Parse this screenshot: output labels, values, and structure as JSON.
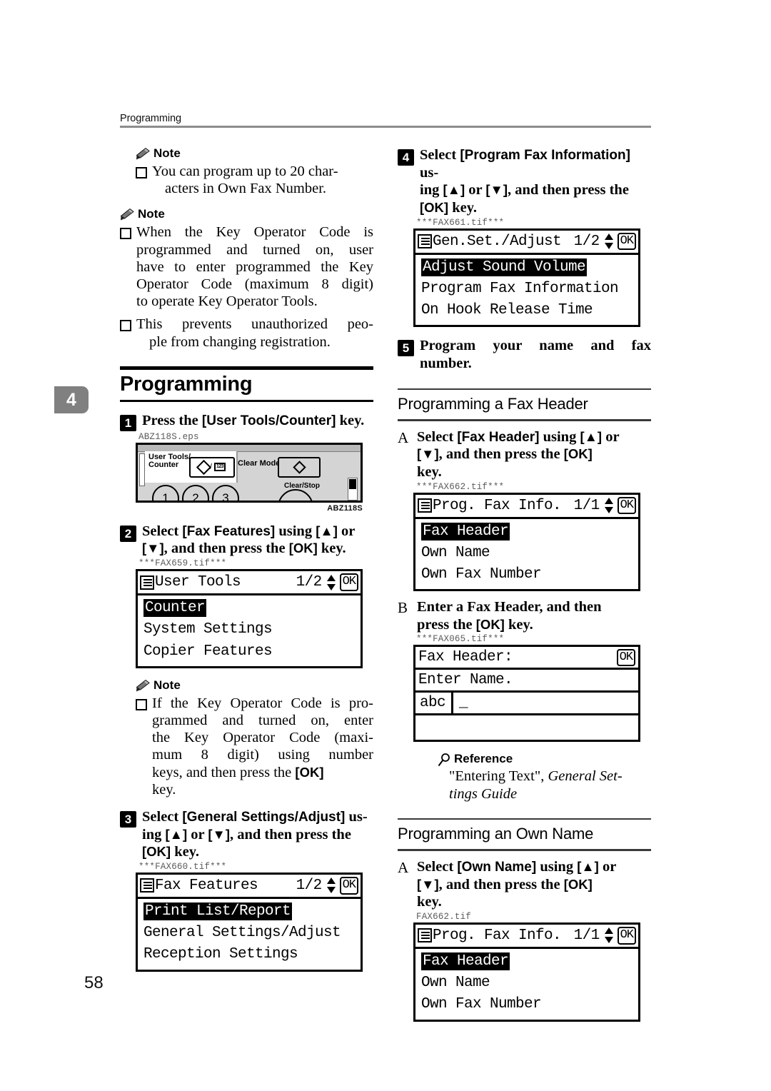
{
  "page": {
    "running_header": "Programming",
    "chapter_tab": "4",
    "folio": "58"
  },
  "left_column": {
    "note1": {
      "heading": "Note",
      "icon": "pencil-icon",
      "items": [
        {
          "line1": "You can program up to 20 char-",
          "line2": "acters in Own Fax Number."
        }
      ]
    },
    "note2": {
      "heading": "Note",
      "icon": "pencil-icon",
      "items": [
        {
          "line1": "When the Key Operator Code is",
          "line2": "programmed and turned on, user",
          "line3": "have to enter programmed the Key",
          "line4": "Operator Code (maximum 8 digit)",
          "line5": "to operate Key Operator Tools."
        },
        {
          "line1": "This prevents unauthorized peo-",
          "line2": "ple from changing registration."
        }
      ]
    },
    "major_heading": "Programming",
    "step1": {
      "number": "1",
      "text_a": "Press the ",
      "key": "[User Tools/Counter]",
      "text_b": " key."
    },
    "figure_panel": {
      "caption": "ABZ118S.eps",
      "credit": "ABZ118S",
      "label_user_tools_1": "User Tools/",
      "label_user_tools_2": "Counter",
      "label_clear_modes": "Clear Modes",
      "label_clear_stop": "Clear/Stop",
      "key_123": "123",
      "numpad": [
        "1",
        "2",
        "3"
      ]
    },
    "step2": {
      "number": "2",
      "line1_a": "Select ",
      "line1_key": "[Fax Features]",
      "line1_b": " using ",
      "line1_up": "[▲]",
      "line1_c": " or",
      "line2_down": "[▼]",
      "line2_a": ", and then press the ",
      "line2_ok": "[OK]",
      "line2_b": " key."
    },
    "lcd_user_tools": {
      "caption": "***FAX659.tif***",
      "title": "User Tools",
      "page_indicator": "1/2",
      "ok_label": "OK",
      "rows": [
        {
          "text": "Counter",
          "highlighted": true
        },
        {
          "text": "System Settings",
          "highlighted": false
        },
        {
          "text": "Copier Features",
          "highlighted": false
        }
      ]
    },
    "note3": {
      "heading": "Note",
      "icon": "pencil-icon",
      "items": [
        {
          "line1": "If the Key Operator Code is pro-",
          "line2": "grammed and turned on, enter",
          "line3": "the Key Operator Code (maxi-",
          "line4": "mum 8 digit) using number",
          "line5_a": "keys, and then press the ",
          "line5_ok": "[OK]",
          "line6": "key."
        }
      ]
    },
    "step3": {
      "number": "3",
      "line1_a": "Select ",
      "line1_key": "[General Settings/Adjust]",
      "line1_b": " us-",
      "line2_a": "ing ",
      "line2_up": "[▲]",
      "line2_b": " or ",
      "line2_down": "[▼]",
      "line2_c": ", and then press the",
      "line3_ok": "[OK]",
      "line3_b": " key."
    },
    "lcd_fax_features": {
      "caption": "***FAX660.tif***",
      "title": "Fax Features",
      "page_indicator": "1/2",
      "ok_label": "OK",
      "rows": [
        {
          "text": "Print List/Report",
          "highlighted": true
        },
        {
          "text": "General Settings/Adjust",
          "highlighted": false
        },
        {
          "text": "Reception Settings",
          "highlighted": false
        }
      ]
    }
  },
  "right_column": {
    "step4": {
      "number": "4",
      "line1_a": "Select ",
      "line1_key": "[Program Fax Information]",
      "line1_b": " us-",
      "line2_a": "ing ",
      "line2_up": "[▲]",
      "line2_b": " or ",
      "line2_down": "[▼]",
      "line2_c": ", and then press the",
      "line3_ok": "[OK]",
      "line3_b": " key."
    },
    "lcd_gen_set": {
      "caption": "***FAX661.tif***",
      "title": "Gen.Set./Adjust",
      "page_indicator": "1/2",
      "ok_label": "OK",
      "rows": [
        {
          "text": "Adjust Sound Volume",
          "highlighted": true
        },
        {
          "text": "Program Fax Information",
          "highlighted": false
        },
        {
          "text": "On Hook Release Time",
          "highlighted": false
        }
      ]
    },
    "step5": {
      "number": "5",
      "line1": "Program your name and fax",
      "line2": "number."
    },
    "section_fax_header": "Programming a Fax Header",
    "substep_A1": {
      "letter": "A",
      "line1_a": "Select ",
      "line1_key": "[Fax Header]",
      "line1_b": " using ",
      "line1_up": "[▲]",
      "line1_c": " or",
      "line2_down": "[▼]",
      "line2_a": ", and then press the ",
      "line2_ok": "[OK]",
      "line3": "key."
    },
    "lcd_prog_fax_info_1": {
      "caption": "***FAX662.tif***",
      "title": "Prog. Fax Info.",
      "page_indicator": "1/1",
      "ok_label": "OK",
      "rows": [
        {
          "text": "Fax Header",
          "highlighted": true
        },
        {
          "text": "Own Name",
          "highlighted": false
        },
        {
          "text": "Own Fax Number",
          "highlighted": false
        }
      ]
    },
    "substep_B": {
      "letter": "B",
      "line1": "Enter a Fax Header, and then",
      "line2_a": "press the ",
      "line2_ok": "[OK]",
      "line2_b": " key."
    },
    "lcd_fax_header_entry": {
      "caption": "***FAX065.tif***",
      "title": "Fax Header:",
      "ok_label": "OK",
      "prompt": "Enter Name.",
      "mode": "abc",
      "cursor": "_"
    },
    "reference": {
      "heading": "Reference",
      "icon": "magnifier-icon",
      "quoted": "\"Entering Text\", ",
      "italic_line1": "General Set-",
      "italic_line2": "tings Guide"
    },
    "section_own_name": "Programming an Own Name",
    "substep_A2": {
      "letter": "A",
      "line1_a": "Select ",
      "line1_key": "[Own Name]",
      "line1_b": " using ",
      "line1_up": "[▲]",
      "line1_c": " or",
      "line2_down": "[▼]",
      "line2_a": ", and then press the ",
      "line2_ok": "[OK]",
      "line3": "key."
    },
    "lcd_prog_fax_info_2": {
      "caption": "FAX662.tif",
      "title": "Prog. Fax Info.",
      "page_indicator": "1/1",
      "ok_label": "OK",
      "rows": [
        {
          "text": "Fax Header",
          "highlighted": true
        },
        {
          "text": "Own Name",
          "highlighted": false
        },
        {
          "text": "Own Fax Number",
          "highlighted": false
        }
      ]
    }
  }
}
